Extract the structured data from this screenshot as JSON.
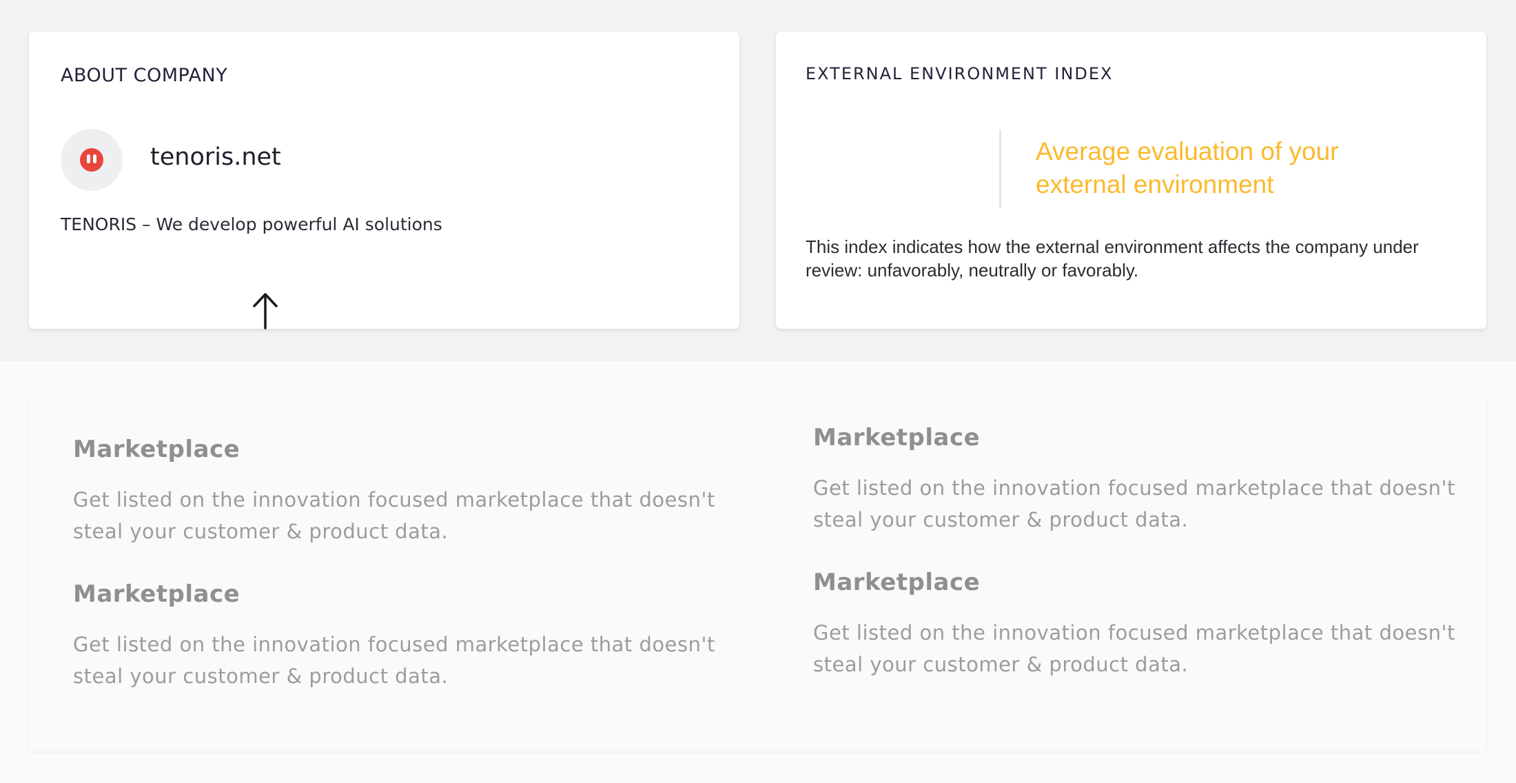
{
  "about_card": {
    "title": "ABOUT COMPANY",
    "company_name": "tenoris.net",
    "tagline": "TENORIS – We develop powerful AI solutions",
    "logo_color": "#e8463c",
    "logo_icon": "tenoris-logo-icon",
    "cursor_icon": "arrow-up-cursor-icon"
  },
  "env_card": {
    "title": "EXTERNAL ENVIRONMENT INDEX",
    "headline": "Average evaluation of your external environment",
    "headline_color": "#fbb92c",
    "description": "This index indicates how the external environment affects the company under review: unfavorably, neutrally or favorably."
  },
  "features": [
    {
      "title": "Marketplace",
      "description": "Get listed on the innovation focused marketplace that doesn't steal your customer & product data."
    },
    {
      "title": "Marketplace",
      "description": "Get listed on the innovation focused marketplace that doesn't steal your customer & product data."
    },
    {
      "title": "Marketplace",
      "description": "Get listed on the innovation focused marketplace that doesn't steal your customer & product data."
    },
    {
      "title": "Marketplace",
      "description": "Get listed on the innovation focused marketplace that doesn't steal your customer & product data."
    }
  ]
}
